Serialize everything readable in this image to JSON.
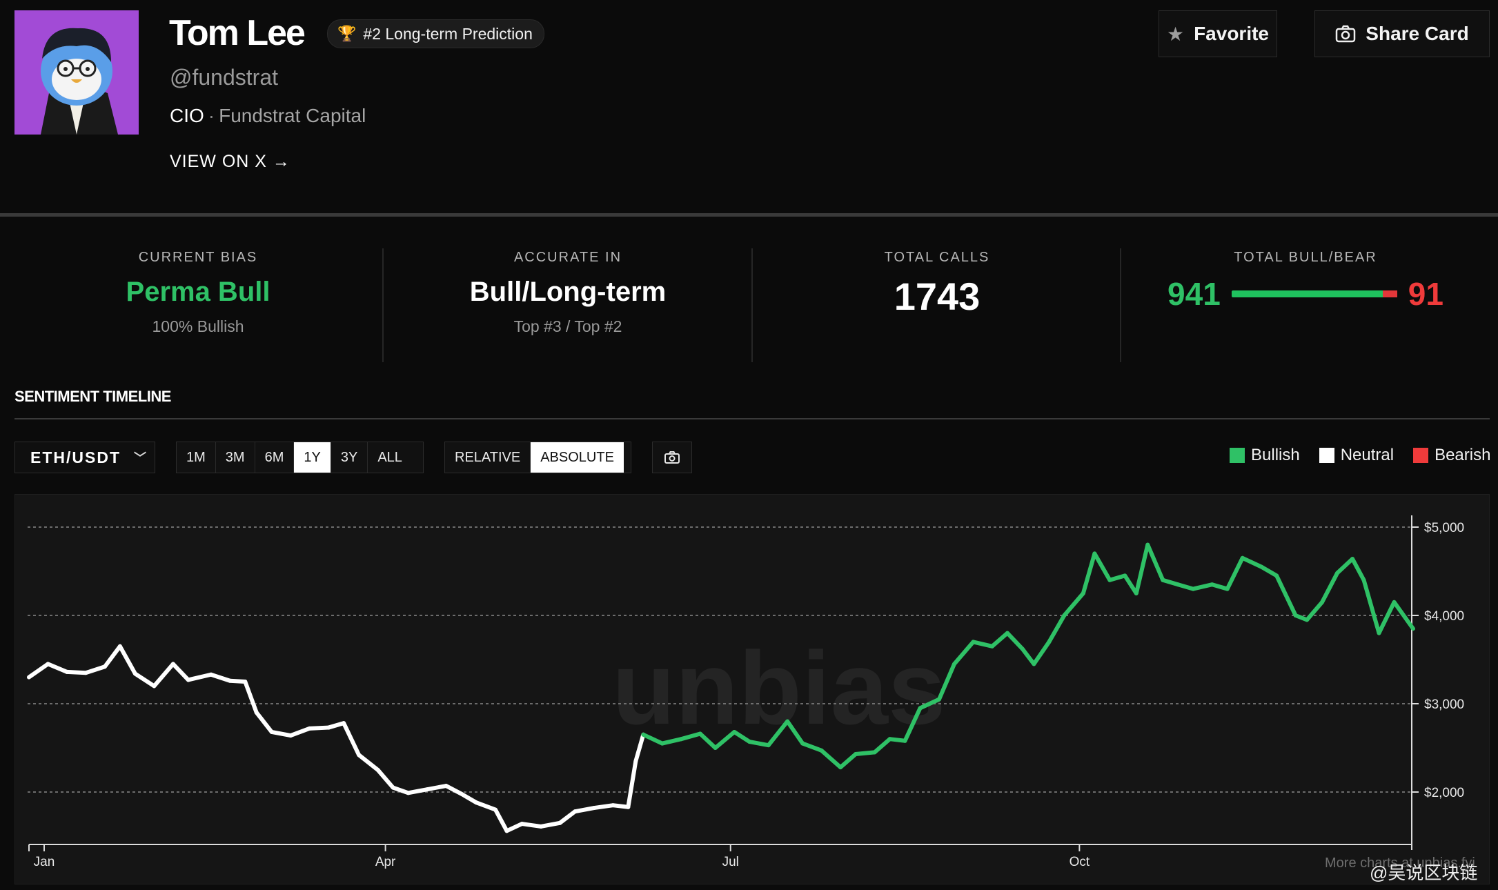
{
  "profile": {
    "name": "Tom Lee",
    "rank_badge": "#2 Long-term Prediction",
    "handle": "@fundstrat",
    "role": "CIO",
    "separator": "·",
    "company": "Fundstrat Capital",
    "view_link": "VIEW ON X →"
  },
  "actions": {
    "favorite_label": "Favorite",
    "share_label": "Share Card"
  },
  "stats": {
    "current_bias": {
      "label": "CURRENT BIAS",
      "value": "Perma Bull",
      "sub": "100% Bullish"
    },
    "accurate_in": {
      "label": "ACCURATE IN",
      "value": "Bull/Long-term",
      "sub": "Top #3 / Top #2"
    },
    "total_calls": {
      "label": "TOTAL CALLS",
      "value": "1743"
    },
    "bull_bear": {
      "label": "TOTAL BULL/BEAR",
      "bull": "941",
      "bear": "91"
    }
  },
  "timeline": {
    "title": "SENTIMENT TIMELINE",
    "pair": "ETH/USDT",
    "ranges": [
      "1M",
      "3M",
      "6M",
      "1Y",
      "3Y",
      "ALL"
    ],
    "active_range": "1Y",
    "modes": [
      "RELATIVE",
      "ABSOLUTE"
    ],
    "active_mode": "ABSOLUTE",
    "legend": [
      {
        "label": "Bullish",
        "color": "#2fc166"
      },
      {
        "label": "Neutral",
        "color": "#ffffff"
      },
      {
        "label": "Bearish",
        "color": "#ef3b3b"
      }
    ],
    "watermark": "unbias",
    "footer_note": "More charts at unbias.fyi"
  },
  "overlay": {
    "source_watermark": "@吴说区块链"
  },
  "colors": {
    "bullish": "#2fc166",
    "neutral": "#ffffff",
    "bearish": "#ef3b3b",
    "avatar_bg": "#a24bd6"
  },
  "chart_data": {
    "type": "line",
    "x_ticks": [
      "Jan",
      "Apr",
      "Jul",
      "Oct"
    ],
    "y_ticks": [
      "$5,000",
      "$4,000",
      "$3,000",
      "$2,000"
    ],
    "y_tick_values": [
      5000,
      4000,
      3000,
      2000
    ],
    "ylim": [
      1500,
      5000
    ],
    "series": [
      {
        "points": [
          {
            "d": "2024-12-28",
            "v": 3300,
            "s": "neutral"
          },
          {
            "d": "2025-01-02",
            "v": 3450,
            "s": "neutral"
          },
          {
            "d": "2025-01-07",
            "v": 3360,
            "s": "neutral"
          },
          {
            "d": "2025-01-12",
            "v": 3350,
            "s": "neutral"
          },
          {
            "d": "2025-01-17",
            "v": 3420,
            "s": "neutral"
          },
          {
            "d": "2025-01-21",
            "v": 3650,
            "s": "neutral"
          },
          {
            "d": "2025-01-25",
            "v": 3340,
            "s": "neutral"
          },
          {
            "d": "2025-01-30",
            "v": 3200,
            "s": "neutral"
          },
          {
            "d": "2025-02-04",
            "v": 3450,
            "s": "neutral"
          },
          {
            "d": "2025-02-08",
            "v": 3270,
            "s": "neutral"
          },
          {
            "d": "2025-02-14",
            "v": 3330,
            "s": "neutral"
          },
          {
            "d": "2025-02-19",
            "v": 3260,
            "s": "neutral"
          },
          {
            "d": "2025-02-23",
            "v": 3250,
            "s": "neutral"
          },
          {
            "d": "2025-02-26",
            "v": 2900,
            "s": "neutral"
          },
          {
            "d": "2025-03-02",
            "v": 2680,
            "s": "neutral"
          },
          {
            "d": "2025-03-07",
            "v": 2640,
            "s": "neutral"
          },
          {
            "d": "2025-03-12",
            "v": 2720,
            "s": "neutral"
          },
          {
            "d": "2025-03-17",
            "v": 2730,
            "s": "neutral"
          },
          {
            "d": "2025-03-21",
            "v": 2780,
            "s": "neutral"
          },
          {
            "d": "2025-03-25",
            "v": 2420,
            "s": "neutral"
          },
          {
            "d": "2025-03-30",
            "v": 2250,
            "s": "neutral"
          },
          {
            "d": "2025-04-03",
            "v": 2050,
            "s": "neutral"
          },
          {
            "d": "2025-04-07",
            "v": 1990,
            "s": "neutral"
          },
          {
            "d": "2025-04-12",
            "v": 2030,
            "s": "neutral"
          },
          {
            "d": "2025-04-17",
            "v": 2070,
            "s": "neutral"
          },
          {
            "d": "2025-04-21",
            "v": 1980,
            "s": "neutral"
          },
          {
            "d": "2025-04-25",
            "v": 1880,
            "s": "neutral"
          },
          {
            "d": "2025-04-30",
            "v": 1800,
            "s": "neutral"
          },
          {
            "d": "2025-05-03",
            "v": 1560,
            "s": "neutral"
          },
          {
            "d": "2025-05-07",
            "v": 1640,
            "s": "neutral"
          },
          {
            "d": "2025-05-12",
            "v": 1610,
            "s": "neutral"
          },
          {
            "d": "2025-05-17",
            "v": 1650,
            "s": "neutral"
          },
          {
            "d": "2025-05-21",
            "v": 1780,
            "s": "neutral"
          },
          {
            "d": "2025-05-26",
            "v": 1820,
            "s": "neutral"
          },
          {
            "d": "2025-05-31",
            "v": 1850,
            "s": "neutral"
          },
          {
            "d": "2025-06-04",
            "v": 1830,
            "s": "neutral"
          },
          {
            "d": "2025-06-06",
            "v": 2350,
            "s": "neutral"
          },
          {
            "d": "2025-06-08",
            "v": 2650,
            "s": "neutral"
          },
          {
            "d": "2025-06-13",
            "v": 2550,
            "s": "bullish"
          },
          {
            "d": "2025-06-18",
            "v": 2600,
            "s": "bullish"
          },
          {
            "d": "2025-06-23",
            "v": 2660,
            "s": "bullish"
          },
          {
            "d": "2025-06-27",
            "v": 2500,
            "s": "bullish"
          },
          {
            "d": "2025-07-02",
            "v": 2680,
            "s": "bullish"
          },
          {
            "d": "2025-07-06",
            "v": 2570,
            "s": "bullish"
          },
          {
            "d": "2025-07-11",
            "v": 2530,
            "s": "bullish"
          },
          {
            "d": "2025-07-16",
            "v": 2800,
            "s": "bullish"
          },
          {
            "d": "2025-07-20",
            "v": 2550,
            "s": "bullish"
          },
          {
            "d": "2025-07-25",
            "v": 2470,
            "s": "bullish"
          },
          {
            "d": "2025-07-30",
            "v": 2280,
            "s": "bullish"
          },
          {
            "d": "2025-08-03",
            "v": 2430,
            "s": "bullish"
          },
          {
            "d": "2025-08-08",
            "v": 2450,
            "s": "bullish"
          },
          {
            "d": "2025-08-12",
            "v": 2600,
            "s": "bullish"
          },
          {
            "d": "2025-08-16",
            "v": 2580,
            "s": "bullish"
          },
          {
            "d": "2025-08-20",
            "v": 2950,
            "s": "bullish"
          },
          {
            "d": "2025-08-25",
            "v": 3050,
            "s": "bullish"
          },
          {
            "d": "2025-08-29",
            "v": 3450,
            "s": "bullish"
          },
          {
            "d": "2025-09-03",
            "v": 3700,
            "s": "bullish"
          },
          {
            "d": "2025-09-08",
            "v": 3650,
            "s": "bullish"
          },
          {
            "d": "2025-09-12",
            "v": 3800,
            "s": "bullish"
          },
          {
            "d": "2025-09-16",
            "v": 3620,
            "s": "bullish"
          },
          {
            "d": "2025-09-19",
            "v": 3450,
            "s": "bullish"
          },
          {
            "d": "2025-09-23",
            "v": 3700,
            "s": "bullish"
          },
          {
            "d": "2025-09-27",
            "v": 4000,
            "s": "bullish"
          },
          {
            "d": "2025-10-02",
            "v": 4250,
            "s": "bullish"
          },
          {
            "d": "2025-10-05",
            "v": 4700,
            "s": "bullish"
          },
          {
            "d": "2025-10-09",
            "v": 4400,
            "s": "bullish"
          },
          {
            "d": "2025-10-13",
            "v": 4450,
            "s": "bullish"
          },
          {
            "d": "2025-10-16",
            "v": 4250,
            "s": "bullish"
          },
          {
            "d": "2025-10-19",
            "v": 4800,
            "s": "bullish"
          },
          {
            "d": "2025-10-23",
            "v": 4400,
            "s": "bullish"
          },
          {
            "d": "2025-10-27",
            "v": 4350,
            "s": "bullish"
          },
          {
            "d": "2025-10-31",
            "v": 4300,
            "s": "bullish"
          },
          {
            "d": "2025-11-05",
            "v": 4350,
            "s": "bullish"
          },
          {
            "d": "2025-11-09",
            "v": 4300,
            "s": "bullish"
          },
          {
            "d": "2025-11-13",
            "v": 4650,
            "s": "bullish"
          },
          {
            "d": "2025-11-18",
            "v": 4550,
            "s": "bullish"
          },
          {
            "d": "2025-11-22",
            "v": 4450,
            "s": "bullish"
          },
          {
            "d": "2025-11-27",
            "v": 4000,
            "s": "bullish"
          },
          {
            "d": "2025-11-30",
            "v": 3950,
            "s": "bullish"
          },
          {
            "d": "2025-12-04",
            "v": 4150,
            "s": "bullish"
          },
          {
            "d": "2025-12-08",
            "v": 4480,
            "s": "bullish"
          },
          {
            "d": "2025-12-12",
            "v": 4640,
            "s": "bullish"
          },
          {
            "d": "2025-12-15",
            "v": 4400,
            "s": "bullish"
          },
          {
            "d": "2025-12-19",
            "v": 3800,
            "s": "bullish"
          },
          {
            "d": "2025-12-23",
            "v": 4150,
            "s": "bullish"
          },
          {
            "d": "2025-12-28",
            "v": 3850,
            "s": "bullish"
          }
        ]
      }
    ]
  }
}
